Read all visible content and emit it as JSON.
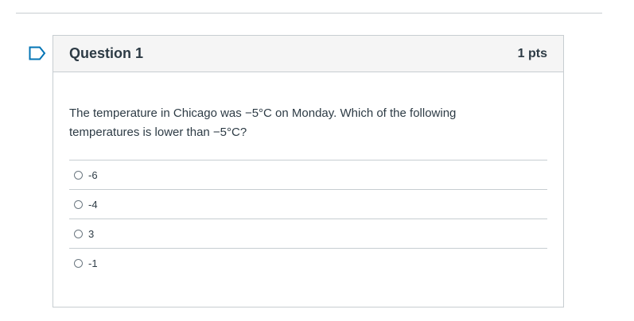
{
  "question": {
    "title": "Question 1",
    "points": "1 pts",
    "text": "The temperature in Chicago was −5°C on Monday. Which of the following temperatures is lower than −5°C?",
    "answers": [
      {
        "label": "-6"
      },
      {
        "label": "-4"
      },
      {
        "label": "3"
      },
      {
        "label": "-1"
      }
    ]
  },
  "colors": {
    "accent": "#0374b5",
    "border": "#c7cdd1",
    "header_bg": "#f5f5f5",
    "text": "#2d3b45"
  },
  "icons": {
    "flag": "bookmark-flag-icon",
    "radio": "radio-circle"
  }
}
